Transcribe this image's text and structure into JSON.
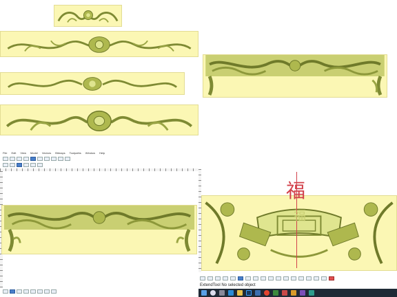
{
  "windows": {
    "left_editor": {
      "menu": [
        "File",
        "Edit",
        "View",
        "Model",
        "Vectors",
        "Bitmaps",
        "Toolpaths",
        "Window",
        "Help"
      ],
      "status": "",
      "toolbar_icons": [
        "select-icon",
        "move-icon",
        "rotate-icon",
        "scale-icon",
        "vector-icon",
        "node-icon",
        "text-icon",
        "zoom-icon",
        "pan-icon",
        "delete-icon"
      ]
    },
    "right_editor": {
      "status": "ExtendTool No selected object",
      "overlay_char": "福",
      "overlay_char2": "福",
      "toolbar_icons": [
        "curve-icon",
        "cut-icon",
        "pointer-icon",
        "line-icon",
        "arc-icon",
        "node-icon",
        "gear-icon",
        "relief-icon",
        "smooth-icon",
        "emboss-icon",
        "sculpt-icon",
        "flip-icon",
        "rotate-icon",
        "move-icon",
        "scale-icon",
        "mirror-icon",
        "wrap-icon",
        "close-icon"
      ]
    }
  },
  "taskbar": {
    "items": [
      "windows-icon",
      "search-icon",
      "task-view-icon",
      "edge-icon",
      "explorer-icon",
      "photoshop-icon",
      "store-icon",
      "chrome-icon",
      "mail-icon",
      "app-icon",
      "app-icon-2",
      "app-icon-3",
      "app-icon-4"
    ],
    "time": ""
  },
  "colors": {
    "canvas": "#fbf7b4",
    "relief_dark": "#6f7a2a",
    "relief_mid": "#aeb84e",
    "relief_light": "#dfe58f",
    "taskbar": "#1f2a36",
    "accent": "#4a7fc9",
    "glyph": "#d2404a"
  }
}
